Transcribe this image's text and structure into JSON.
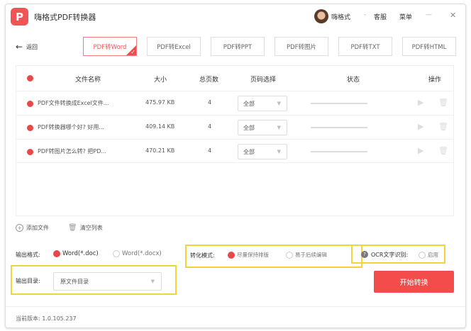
{
  "app": {
    "title": "嗨格式PDF转换器",
    "username": "嗨格式",
    "separator": "-",
    "service": "客服",
    "menu": "菜单",
    "minimize": "—",
    "close": "✕"
  },
  "nav": {
    "back": "返回",
    "tabs": [
      {
        "label": "PDF转Word",
        "active": true
      },
      {
        "label": "PDF转Excel"
      },
      {
        "label": "PDF转PPT"
      },
      {
        "label": "PDF转图片"
      },
      {
        "label": "PDF转TXT"
      },
      {
        "label": "PDF转HTML"
      }
    ]
  },
  "table": {
    "headers": {
      "name": "文件名称",
      "size": "大小",
      "pages": "总页数",
      "range": "页码选择",
      "status": "状态",
      "actions": "操作"
    },
    "rows": [
      {
        "name": "PDF文件转换成Excel文件...",
        "size": "475.97 KB",
        "pages": "4",
        "range": "全部"
      },
      {
        "name": "PDF转换器哪个好? 好用...",
        "size": "409.14 KB",
        "pages": "4",
        "range": "全部"
      },
      {
        "name": "PDF转图片怎么转? 把PD...",
        "size": "470.21 KB",
        "pages": "4",
        "range": "全部"
      }
    ]
  },
  "actions": {
    "add_file": "添加文件",
    "clear_list": "清空列表"
  },
  "output_format": {
    "label": "输出格式:",
    "options": [
      "Word(*.doc)",
      "Word(*.docx)"
    ],
    "selected": 0
  },
  "convert_mode": {
    "label": "转化模式:",
    "options": [
      "尽量保持排版",
      "易于后续编辑"
    ],
    "selected": 0
  },
  "ocr": {
    "label": "OCR文字识别:",
    "option": "启用",
    "enabled": false
  },
  "output_dir": {
    "label": "输出目录:",
    "value": "原文件目录"
  },
  "start_button": "开始转换",
  "footer": {
    "version": "当前版本: 1.0.105.237"
  },
  "colors": {
    "accent": "#f44b4b",
    "highlight": "#f2d43d"
  }
}
